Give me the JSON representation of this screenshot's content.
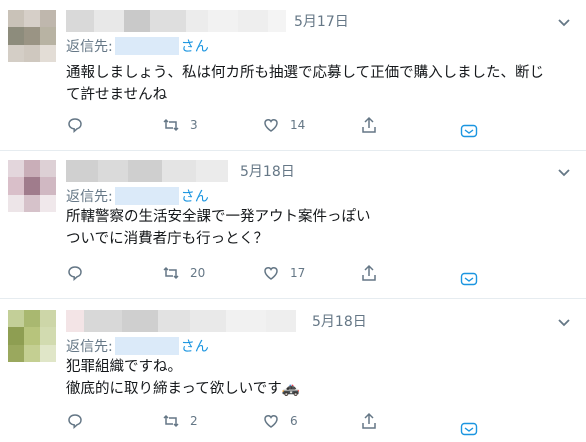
{
  "colors": {
    "accent": "#1b95e0",
    "muted": "#657786",
    "text": "#14171a",
    "divider": "#e6ecf0"
  },
  "tweets": [
    {
      "date": "5月17日",
      "reply_prefix": "返信先:",
      "reply_suffix": "さん",
      "lines": [
        "通報しましょう、私は何カ所も抽選で応募して正価で購入しました、断じ",
        "て許せませんね"
      ],
      "reply_count": "",
      "retweet_count": "3",
      "like_count": "14",
      "avatar_colors": [
        "#c9c2b8",
        "#d6cfc8",
        "#bfb7ad",
        "#8d8c7c",
        "#9a9484",
        "#b8b3a3",
        "#d4cec6",
        "#cfc8bf",
        "#e3ddd6"
      ],
      "name_mosaic": [
        "#d9d9d9",
        "#e8e8e8",
        "#c9c9c9",
        "#dedede",
        "#ececec",
        "#f2f2f2",
        "#eeeeee",
        "#f4f4f4"
      ]
    },
    {
      "date": "5月18日",
      "reply_prefix": "返信先:",
      "reply_suffix": "さん",
      "lines": [
        "所轄警察の生活安全課で一発アウト案件っぽい",
        "ついでに消費者庁も行っとく？"
      ],
      "reply_count": "",
      "retweet_count": "20",
      "like_count": "17",
      "avatar_colors": [
        "#e3d6dc",
        "#c9aeb8",
        "#ddd0d5",
        "#d9bfc9",
        "#a07c8c",
        "#d0b8c2",
        "#ede5e8",
        "#d6c2ca",
        "#f0e8eb"
      ],
      "name_mosaic": [
        "#d0d0d0",
        "#dadada",
        "#cfcfcf",
        "#e4e4e4",
        "#ebebeb"
      ]
    },
    {
      "date": "5月18日",
      "reply_prefix": "返信先:",
      "reply_suffix": "さん",
      "lines": [
        "犯罪組織ですね。",
        "徹底的に取り締まって欲しいです🚓"
      ],
      "reply_count": "",
      "retweet_count": "2",
      "like_count": "6",
      "avatar_colors": [
        "#c3cf98",
        "#a9b870",
        "#cdd6a8",
        "#8e9e52",
        "#b7c47c",
        "#d2dbb0",
        "#9aa85e",
        "#c4cf92",
        "#e0e6c8"
      ],
      "name_mosaic": [
        "#f3e4e6",
        "#d8d8d8",
        "#cfcfcf",
        "#e2e2e2",
        "#e9e9e9",
        "#f1f1f1",
        "#eeeeee"
      ]
    }
  ]
}
